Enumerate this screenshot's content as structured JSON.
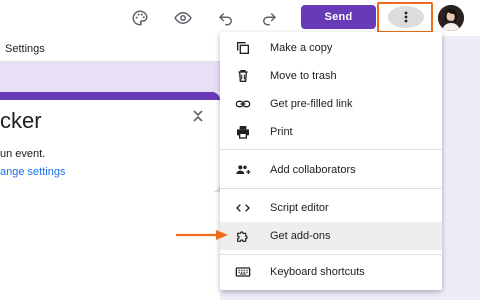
{
  "toolbar": {
    "send_label": "Send",
    "icons": [
      "palette-icon",
      "eye-icon",
      "undo-icon",
      "redo-icon",
      "more-vert-icon"
    ]
  },
  "tabs": {
    "settings_label": "Settings"
  },
  "form": {
    "title_fragment": "cker",
    "description_fragment": "un event.",
    "link_fragment": "ange settings"
  },
  "menu": {
    "items": [
      {
        "label": "Make a copy",
        "icon": "copy-icon"
      },
      {
        "label": "Move to trash",
        "icon": "trash-icon"
      },
      {
        "label": "Get pre-filled link",
        "icon": "link-icon"
      },
      {
        "label": "Print",
        "icon": "print-icon"
      },
      {
        "label": "Add collaborators",
        "icon": "add-people-icon"
      },
      {
        "label": "Script editor",
        "icon": "code-icon"
      },
      {
        "label": "Get add-ons",
        "icon": "puzzle-icon"
      },
      {
        "label": "Keyboard shortcuts",
        "icon": "keyboard-icon"
      }
    ],
    "highlighted_item": "Get add-ons"
  },
  "colors": {
    "accent": "#673ab7",
    "annotation": "#ef6c1a",
    "link": "#1a73e8"
  }
}
